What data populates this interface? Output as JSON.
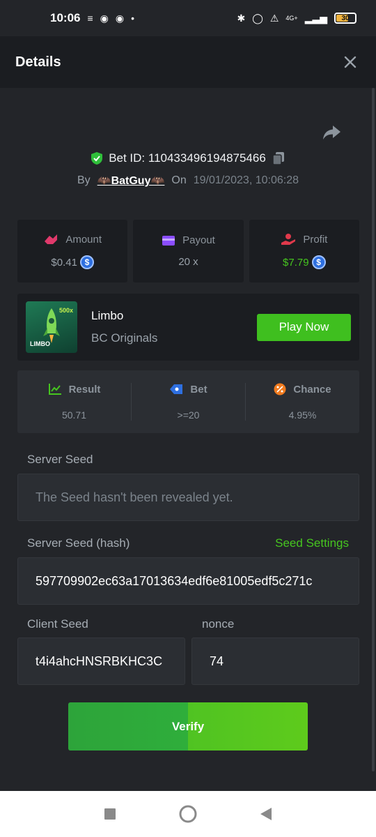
{
  "status_bar": {
    "time": "10:06",
    "network": "4G+",
    "battery": "30"
  },
  "header": {
    "title": "Details"
  },
  "bet": {
    "id_label": "Bet ID: 110433496194875466",
    "by_label": "By",
    "user": "🦇BatGuy🦇",
    "on_label": "On",
    "date": "19/01/2023, 10:06:28"
  },
  "stats": {
    "amount_label": "Amount",
    "amount_value": "$0.41",
    "payout_label": "Payout",
    "payout_value": "20 x",
    "profit_label": "Profit",
    "profit_value": "$7.79",
    "coin_symbol": "$"
  },
  "game": {
    "thumb_tag": "LIMBO",
    "thumb_mult": "500x",
    "name": "Limbo",
    "provider": "BC Originals",
    "play_label": "Play Now"
  },
  "result": {
    "result_label": "Result",
    "result_value": "50.71",
    "bet_label": "Bet",
    "bet_value": ">=20",
    "chance_label": "Chance",
    "chance_value": "4.95%"
  },
  "seeds": {
    "server_seed_label": "Server Seed",
    "server_seed_value": "The Seed hasn't been revealed yet.",
    "server_hash_label": "Server Seed (hash)",
    "seed_settings_label": "Seed Settings",
    "server_hash_value": "597709902ec63a17013634edf6e81005edf5c271c",
    "client_seed_label": "Client Seed",
    "client_seed_value": "t4i4ahcHNSRBKHC3C",
    "nonce_label": "nonce",
    "nonce_value": "74"
  },
  "actions": {
    "verify_label": "Verify"
  },
  "colors": {
    "accent_green": "#46c51f",
    "background": "#232529",
    "panel": "#1b1d21"
  }
}
